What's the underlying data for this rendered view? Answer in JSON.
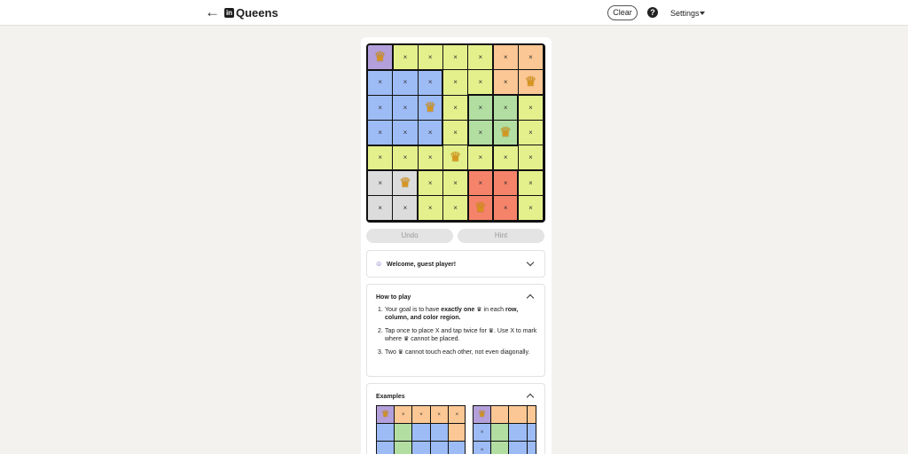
{
  "header": {
    "back_icon": "arrow-left-icon",
    "logo_letters": "in",
    "title": "Queens",
    "clear_label": "Clear",
    "help_label": "?",
    "settings_label": "Settings"
  },
  "board": {
    "size": 7,
    "colors": {
      "P": "#b3a0db",
      "Y": "#e4f08c",
      "O": "#fbc794",
      "B": "#9dbbf5",
      "G": "#b2dea2",
      "W": "#dcdcdc",
      "R": "#f5836a"
    },
    "regions": [
      "PYYYYOO",
      "BBBYYOO",
      "BBBYGGY",
      "BBBYGGY",
      "YYYYYYY",
      "WWYYRRY",
      "WWYYRRY"
    ],
    "marks": [
      "QXXXXXX",
      "XXXXXXQ",
      "XXQXXXX",
      "XXXXXQX",
      "XXXQXXX",
      "XQXXXXX",
      "XXXXQXX"
    ],
    "queen_glyph": "♛",
    "x_glyph": "×"
  },
  "actions": {
    "undo_label": "Undo",
    "hint_label": "Hint"
  },
  "welcome": {
    "title": "Welcome, guest player!"
  },
  "how_to_play": {
    "title": "How to play",
    "rule1_pre": "Your goal is to have ",
    "rule1_bold1": "exactly one",
    "rule1_mid": " in each ",
    "rule1_bold2": "row, column, and color region.",
    "rule2_pre": "Tap once to place X and tap twice for ",
    "rule2_mid": ". Use X to mark where ",
    "rule2_post": " cannot be placed.",
    "rule3_pre": "Two ",
    "rule3_post": " cannot touch each other, not even diagonally."
  },
  "examples": {
    "title": "Examples",
    "example1": {
      "regions": [
        "POOOOO",
        "BGBBOB",
        "BGBBBB"
      ],
      "marks": [
        "QXXXX ",
        "      ",
        "      "
      ]
    },
    "example2": {
      "regions": [
        "POOOOO",
        "BGBBBO",
        "BGBBBB"
      ],
      "marks": [
        "Q     ",
        "X     ",
        "X     "
      ]
    }
  }
}
